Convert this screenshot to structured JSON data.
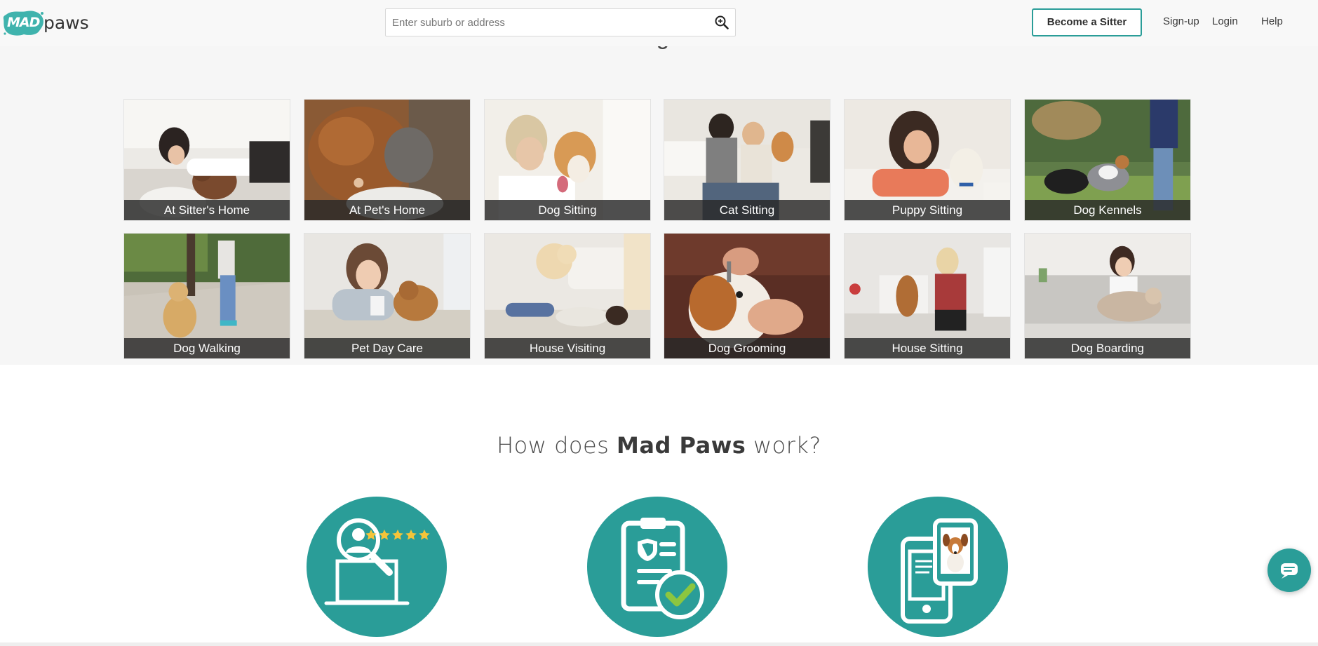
{
  "brand": {
    "logo_mad": "MAD",
    "logo_paws": "paws",
    "accent_color": "#2a9d98"
  },
  "header": {
    "search_placeholder": "Enter suburb or address",
    "become_sitter": "Become a Sitter",
    "signup": "Sign-up",
    "login": "Login",
    "help": "Help"
  },
  "services": {
    "partial_heading": "g",
    "tiles": [
      {
        "label": "At Sitter's Home"
      },
      {
        "label": "At Pet's Home"
      },
      {
        "label": "Dog Sitting"
      },
      {
        "label": "Cat Sitting"
      },
      {
        "label": "Puppy Sitting"
      },
      {
        "label": "Dog Kennels"
      },
      {
        "label": "Dog Walking"
      },
      {
        "label": "Pet Day Care"
      },
      {
        "label": "House Visiting"
      },
      {
        "label": "Dog Grooming"
      },
      {
        "label": "House Sitting"
      },
      {
        "label": "Dog Boarding"
      }
    ]
  },
  "how": {
    "title_prefix": "How does ",
    "title_brand": "Mad Paws",
    "title_suffix": " work?",
    "steps": [
      {
        "icon": "search-reviews-icon"
      },
      {
        "icon": "checklist-approved-icon"
      },
      {
        "icon": "mobile-pet-photo-icon"
      }
    ]
  },
  "chat": {
    "icon": "chat-icon"
  }
}
